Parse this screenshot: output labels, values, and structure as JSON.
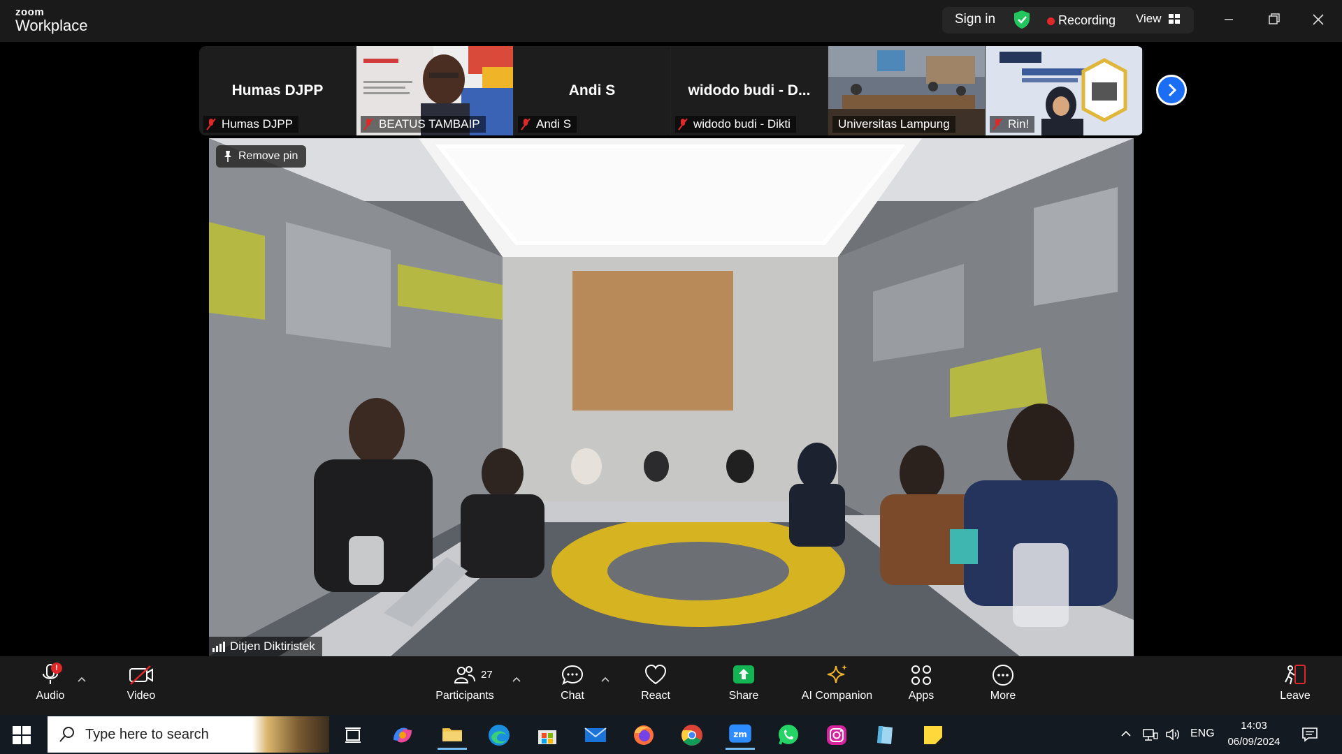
{
  "app": {
    "brand_small": "zoom",
    "brand_large": "Workplace",
    "sign_in": "Sign in",
    "recording": "Recording",
    "view": "View"
  },
  "filmstrip": {
    "tiles": [
      {
        "display_name": "Humas DJPP",
        "label": "Humas DJPP",
        "muted": true,
        "video": false
      },
      {
        "display_name": "",
        "label": "BEATUS TAMBAIP",
        "muted": true,
        "video": true
      },
      {
        "display_name": "Andi S",
        "label": "Andi S",
        "muted": true,
        "video": false
      },
      {
        "display_name": "widodo budi - D...",
        "label": "widodo budi - Dikti",
        "muted": true,
        "video": false
      },
      {
        "display_name": "",
        "label": "Universitas Lampung",
        "muted": false,
        "video": true
      },
      {
        "display_name": "",
        "label": "Rin!",
        "muted": true,
        "video": true
      }
    ]
  },
  "main_video": {
    "pin_label": "Remove pin",
    "speaker_label": "Ditjen Diktiristek"
  },
  "toolbar": {
    "audio": "Audio",
    "audio_badge": "!",
    "video": "Video",
    "participants": "Participants",
    "participants_count": "27",
    "chat": "Chat",
    "react": "React",
    "share": "Share",
    "ai_companion": "AI Companion",
    "apps": "Apps",
    "more": "More",
    "leave": "Leave"
  },
  "taskbar": {
    "search_placeholder": "Type here to search",
    "language": "ENG",
    "time": "14:03",
    "date": "06/09/2024",
    "apps": [
      "task-view",
      "copilot",
      "file-explorer",
      "edge",
      "microsoft-store",
      "mail",
      "firefox",
      "chrome",
      "zoom",
      "whatsapp",
      "instagram",
      "notepad",
      "sticky-notes"
    ]
  },
  "colors": {
    "accent_blue": "#1b6ef3",
    "share_green": "#12b454",
    "record_red": "#e02828",
    "leave_red": "#e02828"
  }
}
